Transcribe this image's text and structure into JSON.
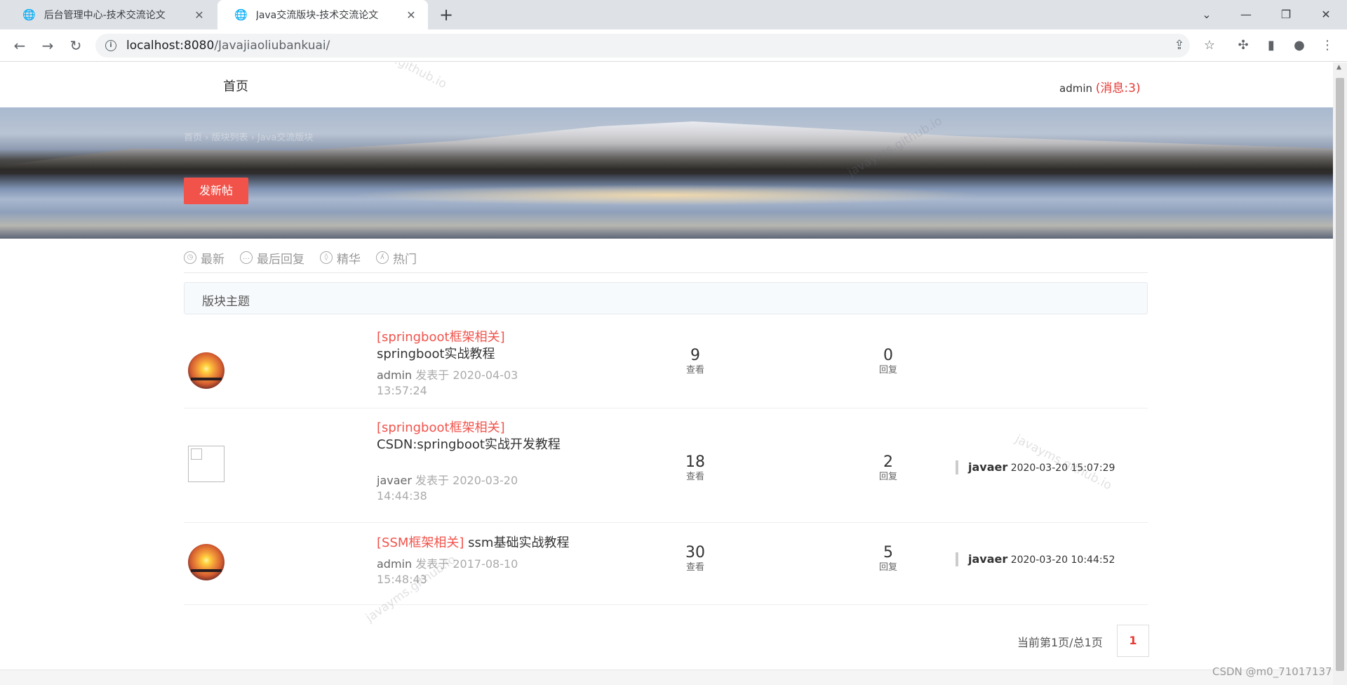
{
  "browser": {
    "tabs": [
      {
        "title": "后台管理中心-技术交流论文",
        "active": false
      },
      {
        "title": "Java交流版块-技术交流论文",
        "active": true
      }
    ],
    "url_host": "localhost:8080",
    "url_path": "/Javajiaoliubankuai/"
  },
  "nav": {
    "home": "首页",
    "username": "admin",
    "messages": "(消息:3)"
  },
  "banner": {
    "breadcrumb": "首页 › 版块列表 › Java交流版块",
    "post_button": "发新帖"
  },
  "filters": [
    "最新",
    "最后回复",
    "精华",
    "热门"
  ],
  "section_title": "版块主题",
  "topics": [
    {
      "category": "[springboot框架相关]",
      "title": "springboot实战教程",
      "author": "admin",
      "posted_label": "发表于",
      "posted": "2020-04-03 13:57:24",
      "views": "9",
      "views_label": "查看",
      "replies": "0",
      "replies_label": "回复",
      "last_user": "",
      "last_time": "",
      "avatar": "sunset"
    },
    {
      "category": "[springboot框架相关]",
      "title": "CSDN:springboot实战开发教程",
      "author": "javaer",
      "posted_label": "发表于",
      "posted": "2020-03-20 14:44:38",
      "views": "18",
      "views_label": "查看",
      "replies": "2",
      "replies_label": "回复",
      "last_user": "javaer",
      "last_time": "2020-03-20 15:07:29",
      "avatar": "broken"
    },
    {
      "category": "[SSM框架相关]",
      "title": "ssm基础实战教程",
      "author": "admin",
      "posted_label": "发表于",
      "posted": "2017-08-10 15:48:43",
      "views": "30",
      "views_label": "查看",
      "replies": "5",
      "replies_label": "回复",
      "last_user": "javaer",
      "last_time": "2020-03-20 10:44:52",
      "avatar": "sunset"
    }
  ],
  "pagination": {
    "label": "当前第1页/总1页",
    "current": "1"
  },
  "watermark": "javayms.github.io",
  "csdn_credit": "CSDN @m0_71017137",
  "colors": {
    "accent": "#f1534b",
    "message": "#e53935"
  }
}
